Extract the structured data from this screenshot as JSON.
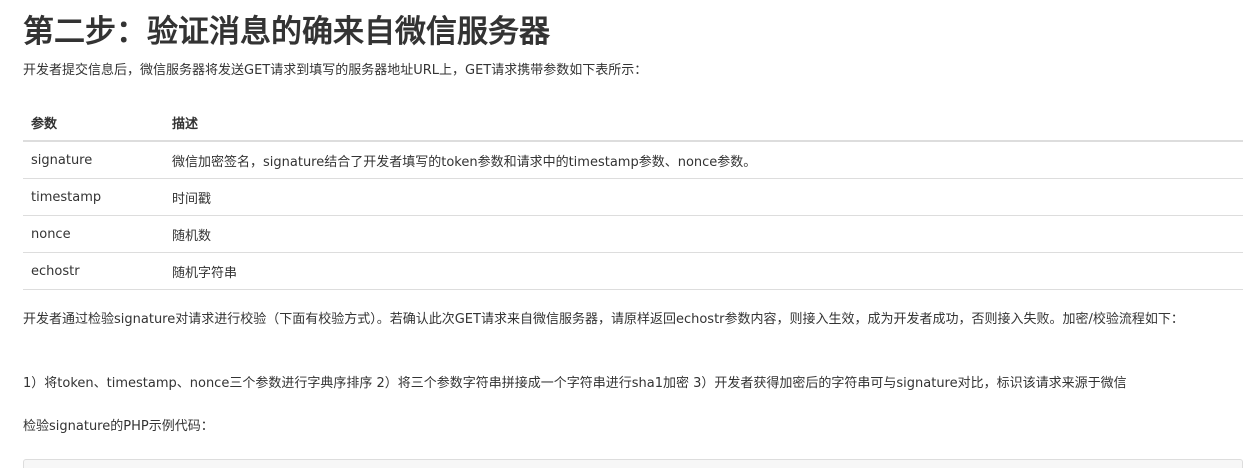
{
  "heading": "第二步：验证消息的确来自微信服务器",
  "intro": "开发者提交信息后，微信服务器将发送GET请求到填写的服务器地址URL上，GET请求携带参数如下表所示：",
  "table": {
    "headers": [
      "参数",
      "描述"
    ],
    "rows": [
      {
        "param": "signature",
        "desc": "微信加密签名，signature结合了开发者填写的token参数和请求中的timestamp参数、nonce参数。"
      },
      {
        "param": "timestamp",
        "desc": "时间戳"
      },
      {
        "param": "nonce",
        "desc": "随机数"
      },
      {
        "param": "echostr",
        "desc": "随机字符串"
      }
    ]
  },
  "paragraph1": "开发者通过检验signature对请求进行校验（下面有校验方式）。若确认此次GET请求来自微信服务器，请原样返回echostr参数内容，则接入生效，成为开发者成功，否则接入失败。加密/校验流程如下：",
  "paragraph2": "1）将token、timestamp、nonce三个参数进行字典序排序 2）将三个参数字符串拼接成一个字符串进行sha1加密 3）开发者获得加密后的字符串可与signature对比，标识该请求来源于微信",
  "paragraph3": "检验signature的PHP示例代码："
}
